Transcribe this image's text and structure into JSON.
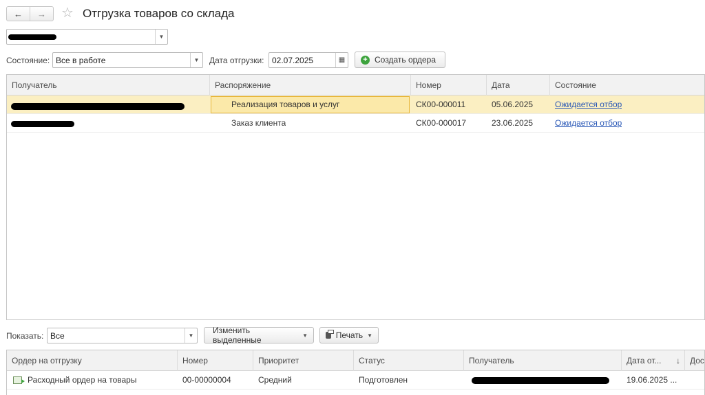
{
  "header": {
    "back_icon": "arrow-left-icon",
    "forward_icon": "arrow-right-icon",
    "favorite_icon": "star-icon",
    "title": "Отгрузка товаров со склада"
  },
  "warehouse_select": {
    "value": "",
    "redacted": true
  },
  "filters": {
    "state_label": "Состояние:",
    "state_value": "Все в работе",
    "date_label": "Дата отгрузки:",
    "date_value": "02.07.2025",
    "create_orders_button": "Создать ордера"
  },
  "orders_table": {
    "columns": [
      "Получатель",
      "Распоряжение",
      "Номер",
      "Дата",
      "Состояние"
    ],
    "rows": [
      {
        "recipient": "",
        "order": "Реализация товаров и услуг",
        "number": "СК00-000011",
        "date": "05.06.2025",
        "state": "Ожидается отбор",
        "selected": true
      },
      {
        "recipient": "",
        "order": "Заказ клиента",
        "number": "СК00-000017",
        "date": "23.06.2025",
        "state": "Ожидается отбор",
        "selected": false
      }
    ]
  },
  "bottom_toolbar": {
    "show_label": "Показать:",
    "show_value": "Все",
    "change_selected_button": "Изменить выделенные",
    "print_button": "Печать"
  },
  "shipments_table": {
    "columns": [
      "Ордер на отгрузку",
      "Номер",
      "Приоритет",
      "Статус",
      "Получатель",
      "Дата от...",
      "Дос"
    ],
    "sort_indicator": "↓",
    "rows": [
      {
        "order": "Расходный ордер на товары",
        "number": "00-00000004",
        "priority": "Средний",
        "status": "Подготовлен",
        "recipient": "",
        "date": "19.06.2025 ..."
      }
    ]
  },
  "colors": {
    "selected_row": "#fbefc2",
    "focus_cell": "#e7b63a",
    "link": "#2a58b6",
    "accent_green": "#3da33d"
  }
}
